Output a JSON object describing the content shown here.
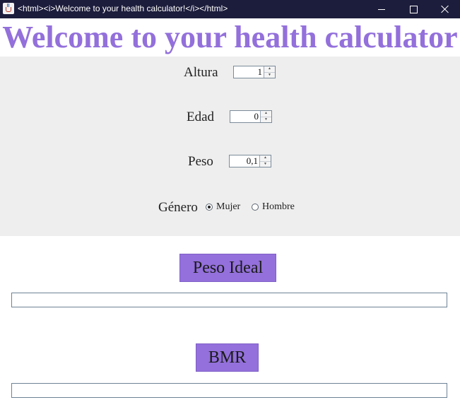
{
  "window": {
    "title": "<html><i>Welcome to your health calculator!</i></html>",
    "app_icon": "java-cup-icon",
    "controls": {
      "minimize": "minimize-icon",
      "maximize": "maximize-icon",
      "close": "close-icon"
    }
  },
  "heading": "Welcome to your health calculator",
  "form": {
    "altura": {
      "label": "Altura",
      "value": "1"
    },
    "edad": {
      "label": "Edad",
      "value": "0"
    },
    "peso": {
      "label": "Peso",
      "value": "0,1"
    },
    "genero": {
      "label": "Género",
      "options": [
        {
          "label": "Mujer",
          "selected": true
        },
        {
          "label": "Hombre",
          "selected": false
        }
      ]
    }
  },
  "actions": {
    "peso_ideal": {
      "label": "Peso Ideal",
      "result": ""
    },
    "bmr": {
      "label": "BMR",
      "result": ""
    }
  },
  "colors": {
    "accent": "#9370db",
    "panel_bg": "#eeeeee",
    "titlebar_bg": "#1c1c3c"
  }
}
